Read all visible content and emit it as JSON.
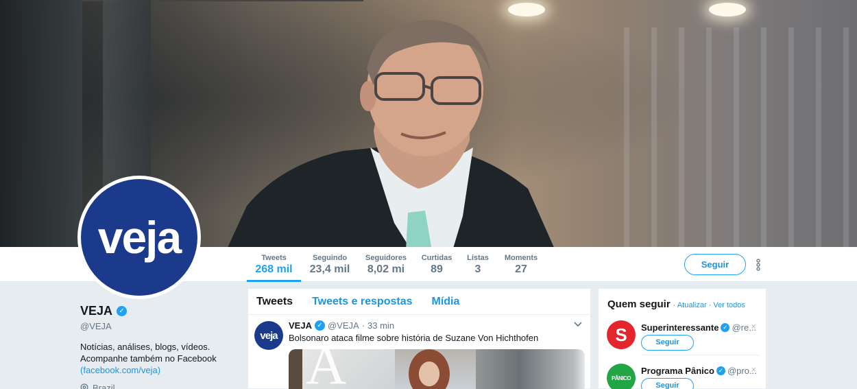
{
  "nav": {
    "stats": [
      {
        "label": "Tweets",
        "value": "268 mil",
        "active": true
      },
      {
        "label": "Seguindo",
        "value": "23,4 mil"
      },
      {
        "label": "Seguidores",
        "value": "8,02 mi"
      },
      {
        "label": "Curtidas",
        "value": "89"
      },
      {
        "label": "Listas",
        "value": "3"
      },
      {
        "label": "Moments",
        "value": "27"
      }
    ],
    "follow_label": "Seguir"
  },
  "profile": {
    "avatar_text": "veja",
    "name": "VEJA",
    "handle": "@VEJA",
    "bio_line1": "Notícias, análises, blogs, vídeos.",
    "bio_line2": "Acompanhe também no Facebook",
    "bio_link": "(facebook.com/veja)",
    "location": "Brazil"
  },
  "timeline": {
    "tabs": [
      "Tweets",
      "Tweets e respostas",
      "Mídia"
    ],
    "tweet": {
      "avatar_text": "veja",
      "name": "VEJA",
      "handle": "@VEJA",
      "sep": "·",
      "time": "33 min",
      "text": "Bolsonaro ataca filme sobre história de Suzane Von Hichthofen"
    }
  },
  "who_to_follow": {
    "title": "Quem seguir",
    "sep": "·",
    "refresh": "Atualizar",
    "view_all": "Ver todos",
    "accounts": [
      {
        "name": "Superinteressante",
        "handle": "@re...",
        "avatar_text": "S",
        "color": "#e3262b",
        "button": "Seguir"
      },
      {
        "name": "Programa Pânico",
        "handle": "@pro...",
        "avatar_text": "PÂNICO",
        "color": "#22a545",
        "button": "Seguir"
      }
    ],
    "dismiss": "×"
  },
  "colors": {
    "accent": "#1da1f2",
    "veja_blue": "#1b3a8c",
    "background": "#e6ecf0"
  }
}
